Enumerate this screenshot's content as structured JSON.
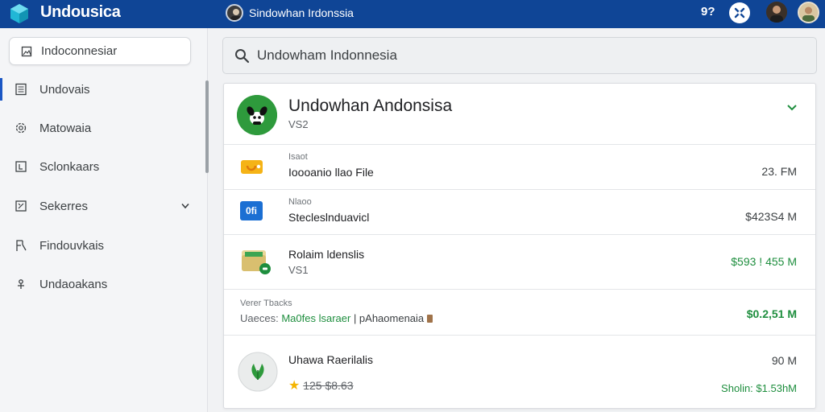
{
  "app": {
    "name": "Undousica",
    "window_title": "Sindowhan Irdonssia"
  },
  "topbar": {
    "help_label": "9?"
  },
  "sidebar": {
    "search_label": "Indoconnesiar",
    "items": [
      {
        "label": "Undovais",
        "icon": "document-icon",
        "active": true
      },
      {
        "label": "Matowaia",
        "icon": "settings-icon",
        "active": false
      },
      {
        "label": "Sclonkaars",
        "icon": "frame-icon",
        "active": false
      },
      {
        "label": "Sekerres",
        "icon": "expand-box-icon",
        "active": false,
        "has_chevron": true
      },
      {
        "label": "Findouvkais",
        "icon": "fork-icon",
        "active": false
      },
      {
        "label": "Undaoakans",
        "icon": "pin-icon",
        "active": false
      }
    ]
  },
  "search": {
    "value": "Undowham Indonnesia"
  },
  "account": {
    "title": "Undowhan Andonsisa",
    "subtitle": "VS2"
  },
  "rows": [
    {
      "small": "Isaot",
      "name": "Ioooanio llao File",
      "amount": "23. FM",
      "amount_style": "plain"
    },
    {
      "small": "Nlaoo",
      "name": "Stecleslnduavicl",
      "amount": "$423S4 M",
      "amount_style": "plain",
      "icon_text": "0fi"
    },
    {
      "name": "Rolaim ldenslis",
      "sub": "VS1",
      "amount": "$593 ! 455 M",
      "amount_style": "green-reg"
    },
    {
      "small": "Verer Tbacks",
      "prefix": "Uaeces:",
      "highlight": "Ma0fes lsaraer",
      "suffix": "| pAhaomenaia",
      "amount": "$0.2,51 M",
      "amount_style": "green"
    },
    {
      "name": "Uhawa Raerilalis",
      "rating_text": "125 $8.63",
      "amount": "90 M",
      "amount2": "Sholin: $1.53hM",
      "amount_style": "plain"
    }
  ],
  "colors": {
    "topbar": "#0f4596",
    "accent_green": "#1e8e3e",
    "active_marker": "#1a56c4"
  }
}
